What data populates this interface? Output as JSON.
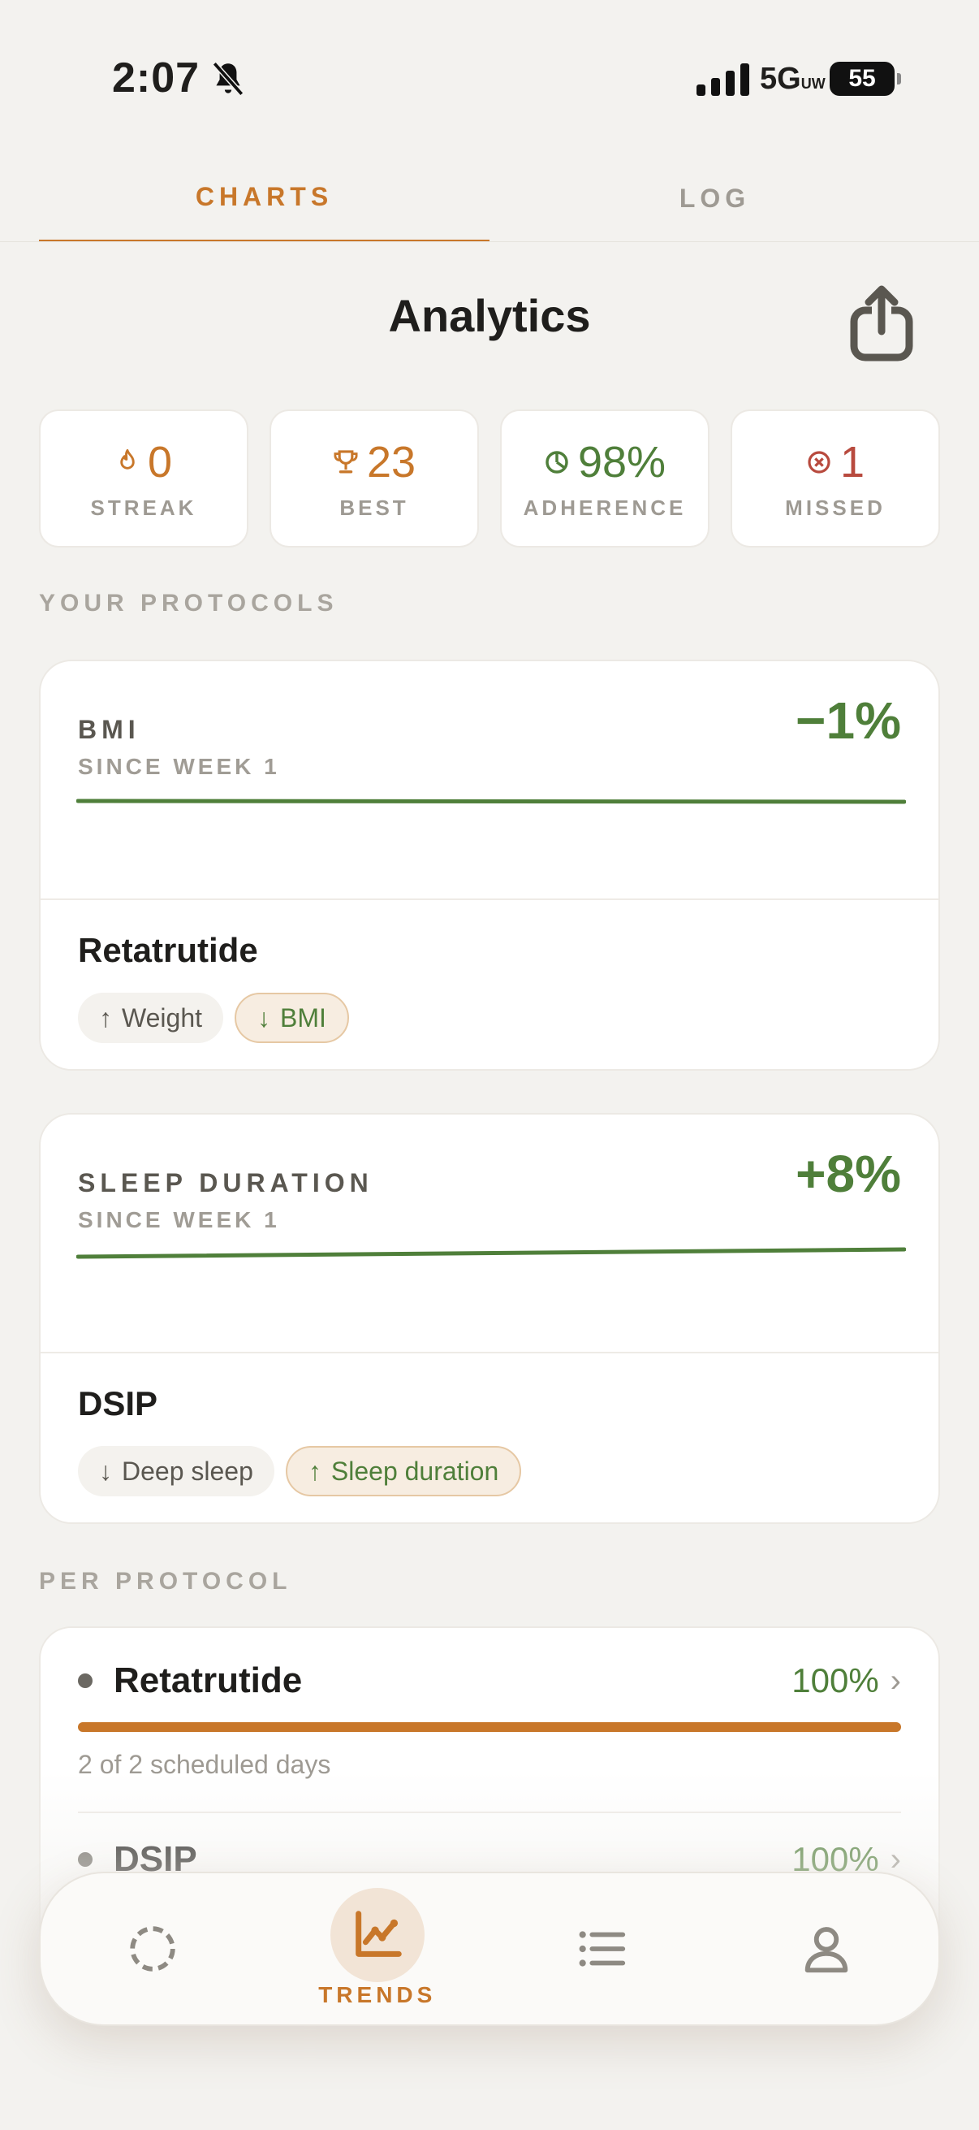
{
  "status_bar": {
    "time": "2:07",
    "network": "5G",
    "network_sub": "UW",
    "battery": "55"
  },
  "tabs": [
    {
      "label": "CHARTS",
      "active": true
    },
    {
      "label": "LOG",
      "active": false
    }
  ],
  "header": {
    "title": "Analytics"
  },
  "stats": [
    {
      "value": "0",
      "label": "STREAK",
      "icon": "flame-icon",
      "color": "#C8772A"
    },
    {
      "value": "23",
      "label": "BEST",
      "icon": "trophy-icon",
      "color": "#C8772A"
    },
    {
      "value": "98%",
      "label": "ADHERENCE",
      "icon": "pie-icon",
      "color": "#4F7F3A"
    },
    {
      "value": "1",
      "label": "MISSED",
      "icon": "x-circle-icon",
      "color": "#B84A3E"
    }
  ],
  "sections": {
    "your_protocols": "YOUR PROTOCOLS",
    "per_protocol": "PER PROTOCOL"
  },
  "protocols": [
    {
      "metric": "BMI",
      "since": "SINCE WEEK 1",
      "delta": "−1%",
      "name": "Retatrutide",
      "chips": [
        {
          "arrow": "↑",
          "label": "Weight"
        },
        {
          "arrow": "↓",
          "label": "BMI"
        }
      ]
    },
    {
      "metric": "SLEEP DURATION",
      "since": "SINCE WEEK 1",
      "delta": "+8%",
      "name": "DSIP",
      "chips": [
        {
          "arrow": "↓",
          "label": "Deep sleep"
        },
        {
          "arrow": "↑",
          "label": "Sleep duration"
        }
      ]
    }
  ],
  "per_protocol": [
    {
      "name": "Retatrutide",
      "percent": "100%",
      "progress": 1.0,
      "sub": "2 of 2 scheduled days"
    },
    {
      "name": "DSIP",
      "percent": "100%"
    }
  ],
  "nav": {
    "active_label": "TRENDS",
    "items": [
      "today-icon",
      "trends-icon",
      "list-icon",
      "profile-icon"
    ]
  },
  "colors": {
    "accent": "#C8772A",
    "positive": "#4F7F3A",
    "negative": "#B84A3E",
    "background": "#F3F2EF"
  }
}
